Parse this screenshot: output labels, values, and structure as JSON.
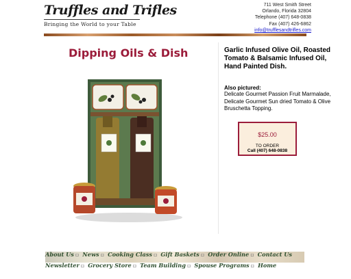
{
  "header": {
    "logo_title": "Truffles and Trifles",
    "logo_tagline": "Bringing the World to your Table",
    "address_lines": [
      "711 West Smith Street",
      "Orlando, Florida 32804",
      "Telephone (407) 648-0838",
      "Fax (407) 426-6862"
    ],
    "email": "info@trufflesandtrifles.com"
  },
  "product": {
    "title": "Dipping Oils & Dish",
    "description": "Garlic Infused Olive Oil, Roasted Tomato & Balsamic Infused Oil, Hand Painted Dish.",
    "also_label": "Also pictured:",
    "also_text": "Delicate Gourmet Passion Fruit Marmalade, Delicate Gourmet Sun dried Tomato & Olive Bruschetta Topping.",
    "price": "$25.00",
    "to_order": "TO ORDER",
    "call": "Call (407) 648-0838"
  },
  "nav": {
    "row1": [
      "About Us",
      "News",
      "Cooking Class",
      "Gift Baskets",
      "Order Online",
      "Contact Us"
    ],
    "row2": [
      "Newsletter",
      "Grocery Store",
      "Team Building",
      "Spouse Programs",
      "Home"
    ]
  },
  "colors": {
    "title": "#9b1c3a",
    "nav_text": "#2f4f2f",
    "price_border": "#9b1c3a",
    "price_bg": "#fbeedd"
  }
}
